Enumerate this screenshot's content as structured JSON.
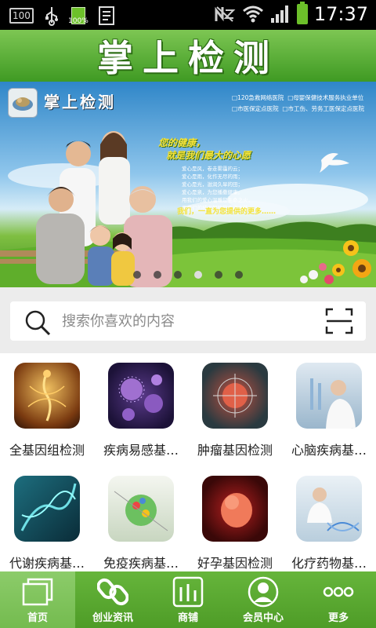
{
  "status_bar": {
    "left_box": "100",
    "battery_small_pct": "100%",
    "time": "17:37"
  },
  "header": {
    "title": "掌上检测"
  },
  "banner": {
    "logo_title": "掌上检测",
    "info_lines": [
      "□120急救网络医院",
      "□母婴保健技术服务执业单位",
      "□市医保定点医院",
      "□市工伤、劳务工医保定点医院"
    ],
    "slogan_line1": "您的健康，",
    "slogan_line2": "就是我们最大的心愿",
    "small_lines": [
      "爱心是风，卷走雾霾的云；",
      "爱心是雨，化作无尽的雨；",
      "爱心是光，滋润久旱的田；",
      "爱心是泉，为您播撒健康。",
      "用我们的爱心温暖您生命之火，",
      "用我们的技术解除您疾病之苦。"
    ],
    "tagline": "我们，一直为您提供的更多……",
    "active_dot": 3,
    "dot_count": 6
  },
  "search": {
    "placeholder": "搜索你喜欢的内容"
  },
  "grid": {
    "items": [
      {
        "label": "全基因组检测",
        "icon": "dna-body-icon"
      },
      {
        "label": "疾病易感基…",
        "icon": "virus-cells-icon"
      },
      {
        "label": "肿瘤基因检测",
        "icon": "tumor-target-icon"
      },
      {
        "label": "心脑疾病基…",
        "icon": "lab-researcher-icon"
      },
      {
        "label": "代谢疾病基…",
        "icon": "dna-helix-icon"
      },
      {
        "label": "免疫疾病基…",
        "icon": "immune-sphere-icon"
      },
      {
        "label": "好孕基因检测",
        "icon": "embryo-icon"
      },
      {
        "label": "化疗药物基…",
        "icon": "doctor-dna-icon"
      }
    ]
  },
  "bottom_nav": {
    "items": [
      {
        "label": "首页",
        "icon": "home-window-icon"
      },
      {
        "label": "创业资讯",
        "icon": "link-chain-icon"
      },
      {
        "label": "商铺",
        "icon": "bar-chart-icon"
      },
      {
        "label": "会员中心",
        "icon": "user-circle-icon"
      },
      {
        "label": "更多",
        "icon": "more-dots-icon"
      }
    ],
    "active_index": 0
  },
  "colors": {
    "brand_green": "#4e9c27",
    "header_green": "#5bae33"
  }
}
